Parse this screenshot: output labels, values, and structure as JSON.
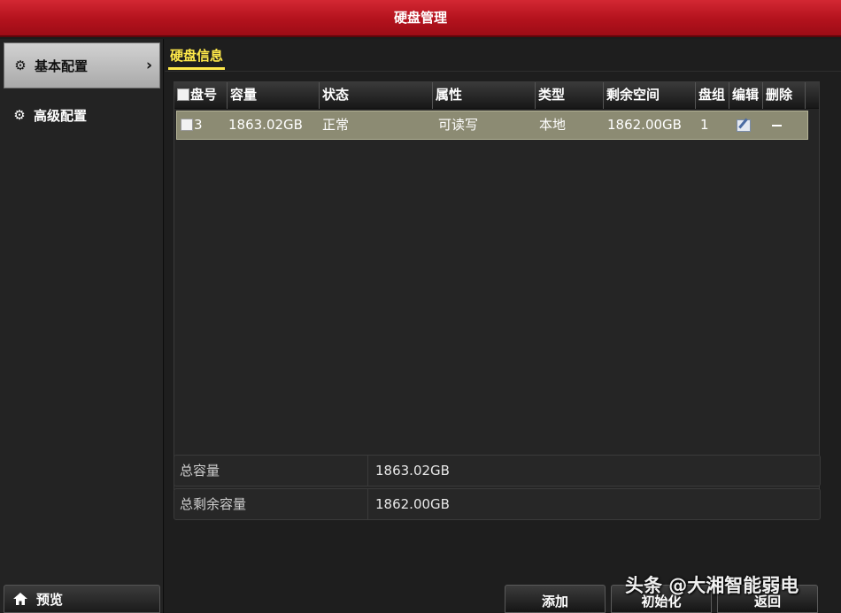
{
  "window": {
    "title": "硬盘管理"
  },
  "sidebar": {
    "items": [
      {
        "label": "基本配置",
        "active": true
      },
      {
        "label": "高级配置",
        "active": false
      }
    ],
    "preview_label": "预览"
  },
  "tabs": [
    {
      "label": "硬盘信息"
    }
  ],
  "table": {
    "headers": [
      "盘号",
      "容量",
      "状态",
      "属性",
      "类型",
      "剩余空间",
      "盘组",
      "编辑",
      "删除"
    ],
    "rows": [
      {
        "disk_no": "3",
        "capacity": "1863.02GB",
        "status": "正常",
        "attribute": "可读写",
        "type": "本地",
        "free_space": "1862.00GB",
        "group": "1",
        "edit_icon": "edit-icon",
        "delete_icon": "minus-icon"
      }
    ]
  },
  "summary": {
    "total_capacity_label": "总容量",
    "total_capacity_value": "1863.02GB",
    "total_free_label": "总剩余容量",
    "total_free_value": "1862.00GB"
  },
  "buttons": {
    "add": "添加",
    "init": "初始化",
    "back": "返回"
  },
  "watermark": "头条 @大湘智能弱电",
  "colors": {
    "title_red": "#c41a24",
    "tab_yellow": "#ffe94a",
    "selected_row": "#8c8b73"
  }
}
